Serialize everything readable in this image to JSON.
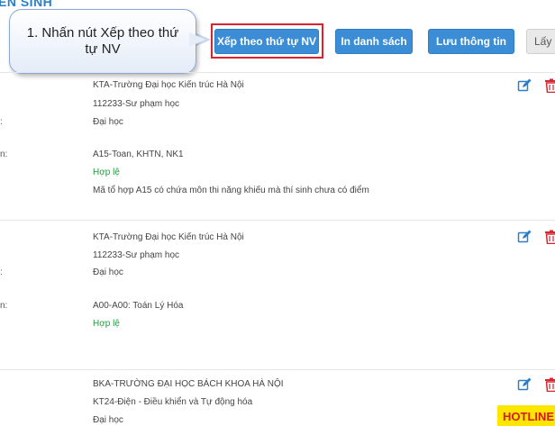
{
  "section": {
    "title": "ÊN SINH"
  },
  "toolbar": {
    "sort_label": "Xếp theo thứ tự NV",
    "print_label": "In danh sách",
    "save_label": "Lưu thông tin",
    "get_label": "Lấy l"
  },
  "callout": {
    "text": "1. Nhấn nút Xếp theo thứ tự NV"
  },
  "labels": {
    "colon": ":",
    "colon_with_n": "n:"
  },
  "records": [
    {
      "school": "KTA-Trường Đại học Kiến trúc Hà Nội",
      "major": "112233-Sư phạm học",
      "level": "Đại học",
      "combination": "A15-Toan, KHTN, NK1",
      "status": "Hợp lệ",
      "note": "Mã tổ hợp A15 có chứa môn thi năng khiếu mà thí sinh chưa có điểm"
    },
    {
      "school": "KTA-Trường Đại học Kiến trúc Hà Nội",
      "major": "112233-Sư phạm học",
      "level": "Đại học",
      "combination": "A00-A00: Toán Lý Hóa",
      "status": "Hợp lệ"
    },
    {
      "school": "BKA-TRƯỜNG ĐẠI HỌC BÁCH KHOA HÀ NỘI",
      "major": "KT24-Điện - Điều khiển và Tự động hóa",
      "level": "Đại học"
    }
  ],
  "hotline": "HOTLINE",
  "colors": {
    "primary_button": "#3b8dd6",
    "highlight": "#d9232e",
    "valid": "#1e9e3a",
    "hotline_bg": "#ffe600"
  }
}
